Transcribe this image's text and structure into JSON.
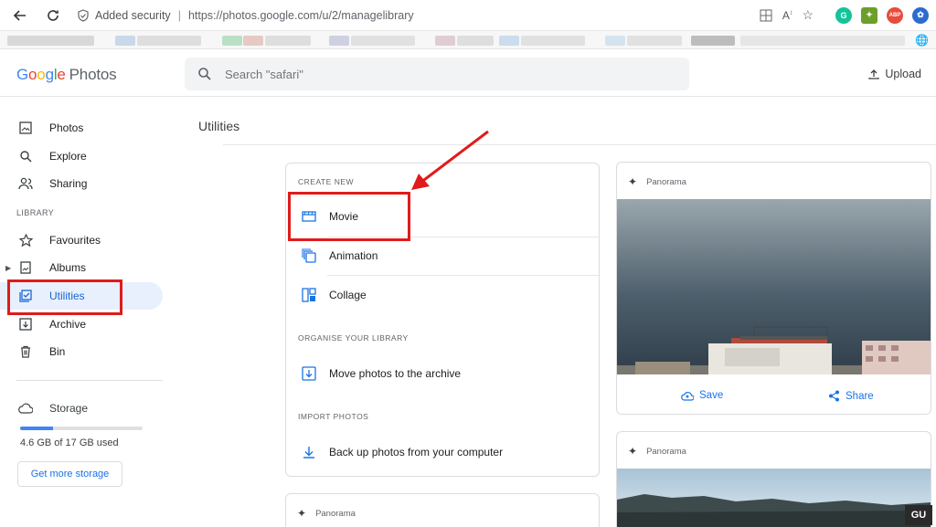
{
  "browser": {
    "security_label": "Added security",
    "url": "https://photos.google.com/u/2/managelibrary"
  },
  "header": {
    "logo_letters": [
      "G",
      "o",
      "o",
      "g",
      "l",
      "e"
    ],
    "logo_product": "Photos",
    "search_placeholder": "Search \"safari\"",
    "upload_label": "Upload"
  },
  "sidebar": {
    "items_top": [
      {
        "label": "Photos",
        "icon": "photo-icon"
      },
      {
        "label": "Explore",
        "icon": "search-icon"
      },
      {
        "label": "Sharing",
        "icon": "people-icon"
      }
    ],
    "library_heading": "LIBRARY",
    "items_library": [
      {
        "label": "Favourites",
        "icon": "star-icon"
      },
      {
        "label": "Albums",
        "icon": "album-icon"
      },
      {
        "label": "Utilities",
        "icon": "utilities-icon",
        "active": true
      },
      {
        "label": "Archive",
        "icon": "archive-icon"
      },
      {
        "label": "Bin",
        "icon": "trash-icon"
      }
    ],
    "storage_title": "Storage",
    "storage_used_text": "4.6 GB of 17 GB used",
    "storage_fraction": 0.27,
    "get_more_label": "Get more storage"
  },
  "main": {
    "title": "Utilities",
    "create_new_heading": "CREATE NEW",
    "create_items": [
      {
        "label": "Movie",
        "icon": "movie-icon"
      },
      {
        "label": "Animation",
        "icon": "animation-icon"
      },
      {
        "label": "Collage",
        "icon": "collage-icon"
      }
    ],
    "organise_heading": "ORGANISE YOUR LIBRARY",
    "organise_item": "Move photos to the archive",
    "import_heading": "IMPORT PHOTOS",
    "import_item": "Back up photos from your computer",
    "panorama_cards": [
      {
        "label": "Panorama",
        "save_label": "Save",
        "share_label": "Share"
      },
      {
        "label": "Panorama"
      },
      {
        "label": "Panorama"
      }
    ]
  },
  "colors": {
    "accent": "#1a73e8",
    "active_bg": "#e8f0fe",
    "annotation_red": "#e01b1b"
  },
  "watermark": "GU"
}
